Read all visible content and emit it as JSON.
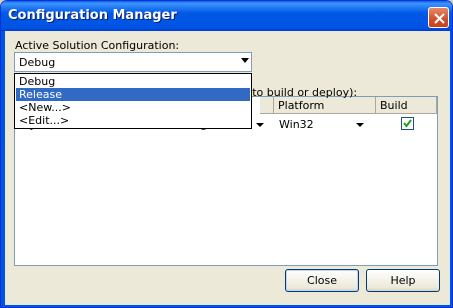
{
  "window": {
    "title": "Configuration Manager"
  },
  "active_config": {
    "label": "Active Solution Configuration:",
    "value": "Debug",
    "options": [
      "Debug",
      "Release",
      "<New...>",
      "<Edit...>"
    ],
    "highlighted": "Release"
  },
  "grid": {
    "caption_fragment": "s to build or deploy):",
    "columns": [
      "Platform",
      "Build"
    ],
    "rows": [
      {
        "project": "Bytes",
        "configuration": "Debug",
        "platform": "Win32",
        "build": true
      }
    ]
  },
  "buttons": {
    "close": "Close",
    "help": "Help"
  }
}
